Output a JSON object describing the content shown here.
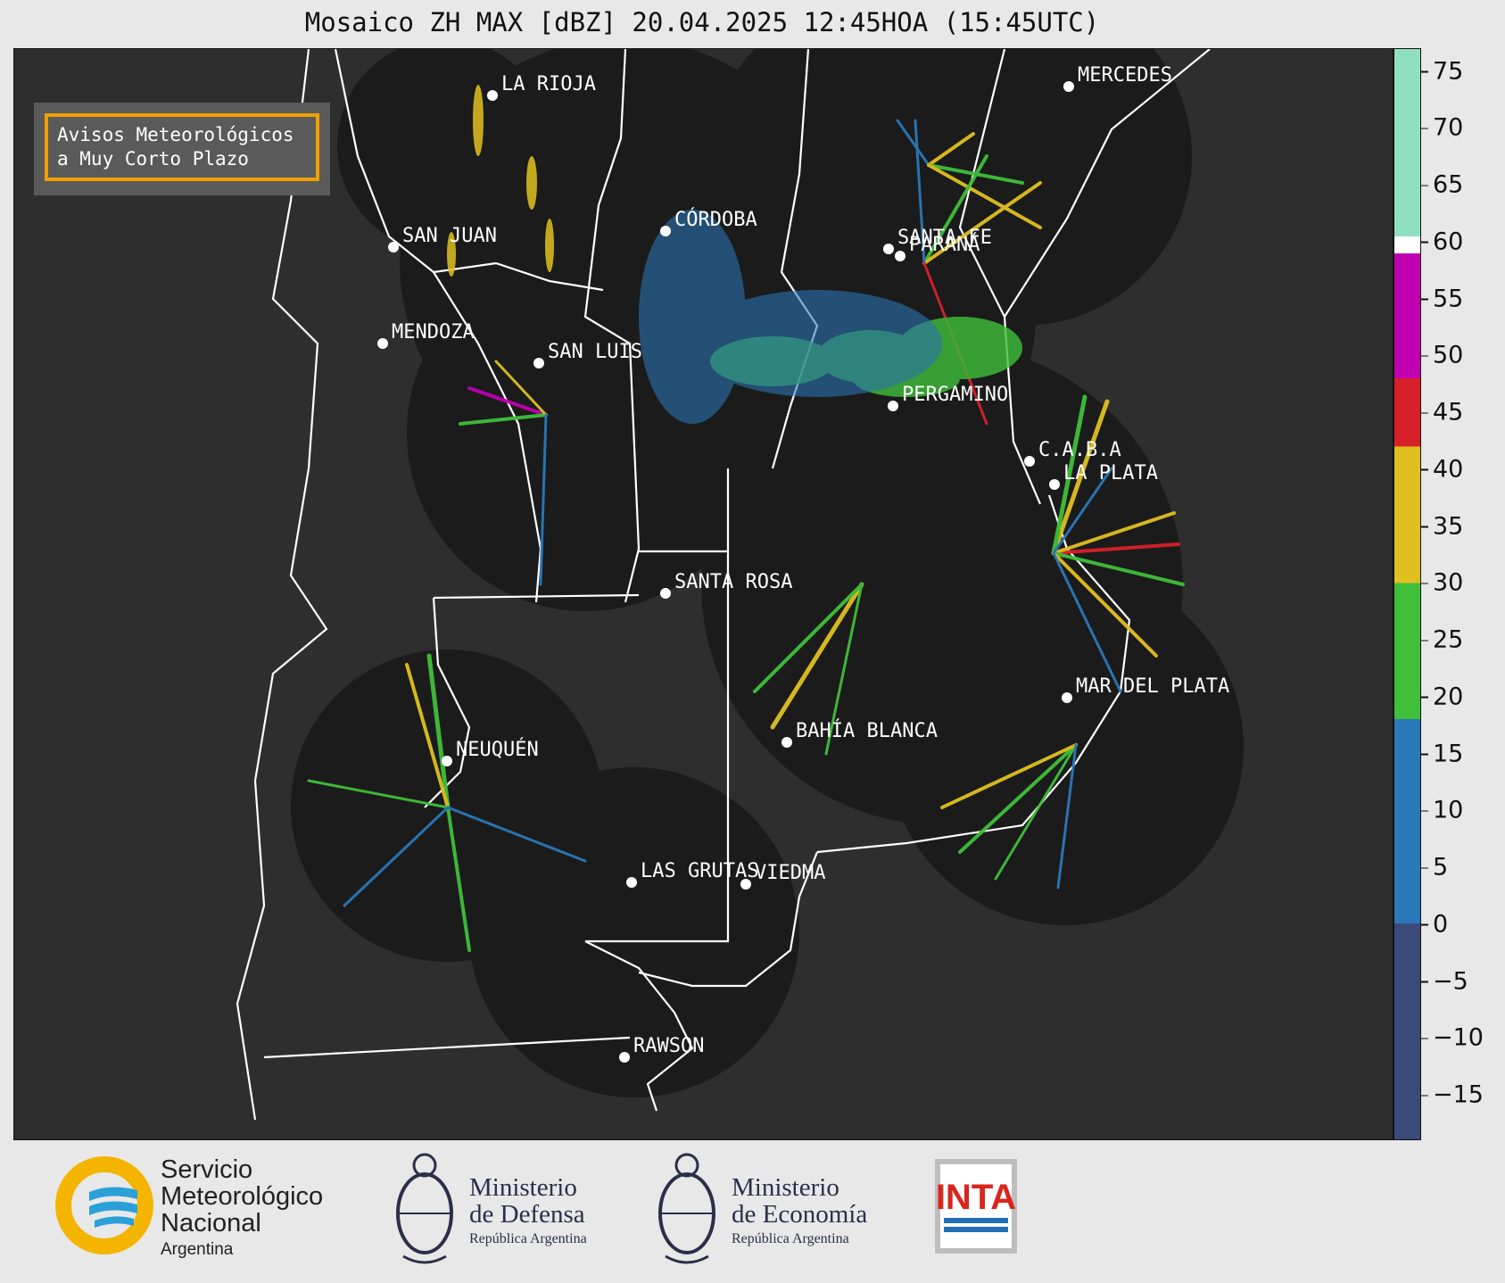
{
  "title": "Mosaico ZH MAX [dBZ] 20.04.2025 12:45HOA (15:45UTC)",
  "avisos": {
    "line1": "Avisos Meteorológicos",
    "line2": "a Muy Corto Plazo"
  },
  "cities": [
    {
      "name": "LA RIOJA"
    },
    {
      "name": "MERCEDES"
    },
    {
      "name": "CÓRDOBA"
    },
    {
      "name": "SAN JUAN"
    },
    {
      "name": "SANTA FE"
    },
    {
      "name": "PARANÁ"
    },
    {
      "name": "MENDOZA"
    },
    {
      "name": "SAN LUIS"
    },
    {
      "name": "PERGAMINO"
    },
    {
      "name": "C.A.B.A"
    },
    {
      "name": "LA PLATA"
    },
    {
      "name": "SANTA ROSA"
    },
    {
      "name": "MAR DEL PLATA"
    },
    {
      "name": "BAHÍA BLANCA"
    },
    {
      "name": "NEUQUÉN"
    },
    {
      "name": "LAS GRUTAS"
    },
    {
      "name": "VIEDMA"
    },
    {
      "name": "RAWSON"
    }
  ],
  "colorbar": {
    "label_unit": "dBZ",
    "min": -19,
    "max": 77,
    "ticks": [
      "75",
      "70",
      "65",
      "60",
      "55",
      "50",
      "45",
      "40",
      "35",
      "30",
      "25",
      "20",
      "15",
      "10",
      "5",
      "0",
      "−5",
      "−10",
      "−15"
    ],
    "tick_values": [
      75,
      70,
      65,
      60,
      55,
      50,
      45,
      40,
      35,
      30,
      25,
      20,
      15,
      10,
      5,
      0,
      -5,
      -10,
      -15
    ],
    "bands": [
      {
        "from": -19,
        "to": 0,
        "color": "#3c4a7a"
      },
      {
        "from": 0,
        "to": 18,
        "color": "#2a78b8"
      },
      {
        "from": 18,
        "to": 30,
        "color": "#3fbf3a"
      },
      {
        "from": 30,
        "to": 42,
        "color": "#e0c020"
      },
      {
        "from": 42,
        "to": 48,
        "color": "#d8202a"
      },
      {
        "from": 48,
        "to": 59,
        "color": "#c000b0"
      },
      {
        "from": 59,
        "to": 60.5,
        "color": "#ffffff"
      },
      {
        "from": 60.5,
        "to": 77,
        "color": "#8ee0c0"
      }
    ]
  },
  "footer": {
    "smn": {
      "l1": "Servicio",
      "l2": "Meteorológico",
      "l3": "Nacional",
      "l4": "Argentina"
    },
    "defensa": {
      "l1": "Ministerio",
      "l2": "de Defensa",
      "l3": "República Argentina"
    },
    "economia": {
      "l1": "Ministerio",
      "l2": "de Economía",
      "l3": "República Argentina"
    },
    "inta": "INTA"
  },
  "colors": {
    "map_bg": "#2e2e2e",
    "radar_disk": "#1b1b1b",
    "accent": "#f0a000"
  }
}
